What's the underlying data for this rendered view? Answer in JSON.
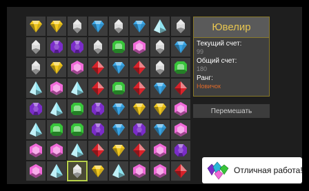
{
  "panel": {
    "title": "Ювелир",
    "current_score_label": "Текущий счет:",
    "current_score": "99",
    "total_score_label": "Общий счет:",
    "total_score": "180",
    "rank_label": "Ранг:",
    "rank": "Новичок"
  },
  "shuffle_button": "Перемешать",
  "toast": {
    "message": "Отличная работа!",
    "icon": "gems-icon"
  },
  "board": {
    "selected": [
      7,
      2
    ],
    "rows": [
      [
        "yellow",
        "yellow",
        "white",
        "blue",
        "white",
        "blue",
        "cyan",
        "white"
      ],
      [
        "white",
        "purple",
        "purple",
        "white",
        "green",
        "pink",
        "white",
        "blue"
      ],
      [
        "white",
        "yellow",
        "pink",
        "red",
        "blue",
        "red",
        "white",
        "green"
      ],
      [
        "cyan",
        "pink",
        "cyan",
        "red",
        "green",
        "red",
        "blue",
        "red"
      ],
      [
        "purple",
        "cyan",
        "green",
        "purple",
        "blue",
        "yellow",
        "yellow",
        "pink"
      ],
      [
        "cyan",
        "green",
        "green",
        "purple",
        "blue",
        "purple",
        "blue",
        "pink"
      ],
      [
        "pink",
        "pink",
        "cyan",
        "red",
        "yellow",
        "red",
        "pink",
        "purple"
      ],
      [
        "pink",
        "cyan",
        "white",
        "yellow",
        "cyan",
        "pink",
        "pink",
        "red"
      ]
    ]
  },
  "colors": {
    "yellow": "#f2c81e",
    "white": "#d9d9d9",
    "blue": "#3aa6e6",
    "cyan": "#8fe3f0",
    "purple": "#7a2cc8",
    "green": "#38c43a",
    "pink": "#f06ad8",
    "red": "#d8222a",
    "accent_title": "#e8c650",
    "rank": "#e06a2a",
    "selected_outline": "#b7d04a"
  }
}
